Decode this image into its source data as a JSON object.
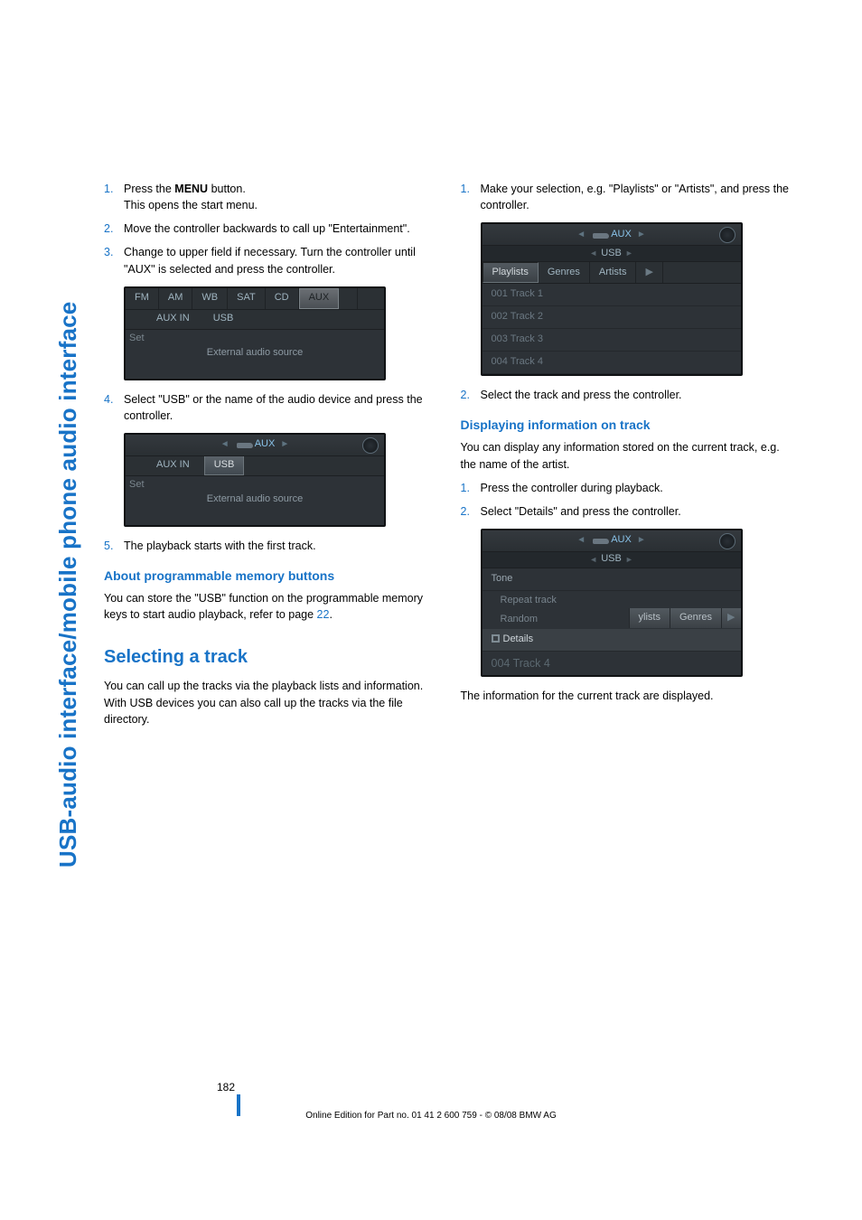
{
  "side_title": "USB-audio interface/mobile phone audio interface",
  "left": {
    "steps1": [
      {
        "num": "1.",
        "html_prefix": "Press the ",
        "bold": "MENU",
        "suffix": " button.",
        "line2": "This opens the start menu."
      },
      {
        "num": "2.",
        "text": "Move the controller backwards to call up \"Entertainment\"."
      },
      {
        "num": "3.",
        "text": "Change to upper field if necessary. Turn the controller until \"AUX\" is selected and press the controller."
      }
    ],
    "idrive1": {
      "tabs": [
        "FM",
        "AM",
        "WB",
        "SAT",
        "CD",
        "AUX"
      ],
      "subtabs": [
        "AUX IN",
        "USB"
      ],
      "set": "Set",
      "msg": "External audio source"
    },
    "steps2": [
      {
        "num": "4.",
        "text": "Select \"USB\" or the name of the audio device and press the controller."
      }
    ],
    "idrive2": {
      "title": "AUX",
      "subtabs": [
        "AUX IN",
        "USB"
      ],
      "set": "Set",
      "msg": "External audio source"
    },
    "steps3": [
      {
        "num": "5.",
        "text": "The playback starts with the first track."
      }
    ],
    "h3a": "About programmable memory buttons",
    "p_about_1": "You can store the \"USB\" function on the programmable memory keys to start audio playback, refer to page ",
    "p_about_link": "22",
    "p_about_2": ".",
    "h2": "Selecting a track",
    "p_sel": "You can call up the tracks via the playback lists and information. With USB devices you can also call up the tracks via the file directory."
  },
  "right": {
    "steps1": [
      {
        "num": "1.",
        "text": "Make your selection, e.g. \"Playlists\" or \"Artists\", and press the controller."
      }
    ],
    "idrive3": {
      "title": "AUX",
      "subtitle": "USB",
      "tabs": [
        "Playlists",
        "Genres",
        "Artists"
      ],
      "tracks": [
        "001 Track 1",
        "002 Track 2",
        "003 Track 3",
        "004 Track 4"
      ]
    },
    "steps2": [
      {
        "num": "2.",
        "text": "Select the track and press the controller."
      }
    ],
    "h3b": "Displaying information on track",
    "p_disp": "You can display any information stored on the current track, e.g. the name of the artist.",
    "steps3": [
      {
        "num": "1.",
        "text": "Press the controller during playback."
      },
      {
        "num": "2.",
        "text": "Select \"Details\" and press the controller."
      }
    ],
    "idrive4": {
      "title": "AUX",
      "subtitle": "USB",
      "menu_top": "Tone",
      "menu_sub1": "Repeat track",
      "menu_sub2": "Random",
      "menu_details": "Details",
      "right_tabs": [
        "ylists",
        "Genres"
      ],
      "last": "004 Track 4"
    },
    "p_info": "The information for the current track are displayed."
  },
  "page_number": "182",
  "footer": "Online Edition for Part no. 01 41 2 600 759 - © 08/08 BMW AG"
}
